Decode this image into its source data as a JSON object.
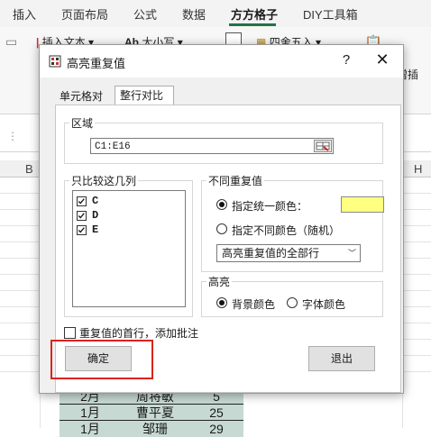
{
  "ribbon": {
    "tabs": [
      "插入",
      "页面布局",
      "公式",
      "数据",
      "方方格子",
      "DIY工具箱"
    ],
    "active_tab": "方方格子",
    "items": {
      "insert_text": "插入文本",
      "case": "大小写",
      "round": "四舍五入",
      "ab_icon": "Ab",
      "right_label": "增插"
    }
  },
  "sheet": {
    "columns": [
      "B",
      "H"
    ],
    "rows": [
      {
        "a": "2月",
        "b": "周将敏",
        "c": "5"
      },
      {
        "a": "1月",
        "b": "曹平夏",
        "c": "25"
      },
      {
        "a": "1月",
        "b": "邹珊",
        "c": "29"
      }
    ]
  },
  "dialog": {
    "title": "高亮重复值",
    "help": "?",
    "close": "✕",
    "tabs": [
      "单元格对比",
      "整行对比"
    ],
    "active_tab": "整行对比",
    "range_group": "区域",
    "range_value": "C1:E16",
    "columns_group": "只比较这几列",
    "columns": [
      {
        "label": "C",
        "checked": true
      },
      {
        "label": "D",
        "checked": true
      },
      {
        "label": "E",
        "checked": true
      }
    ],
    "nonrepeat_group": "不同重复值",
    "opt_uniform": "指定统一颜色：",
    "opt_different": "指定不同颜色（随机）",
    "uniform_color": "#ffff80",
    "dropdown_value": "高亮重复值的全部行",
    "highlight_group": "高亮",
    "opt_bg": "背景颜色",
    "opt_font": "字体颜色",
    "first_row_note": "重复值的首行，添加批注",
    "ok": "确定",
    "exit": "退出"
  }
}
